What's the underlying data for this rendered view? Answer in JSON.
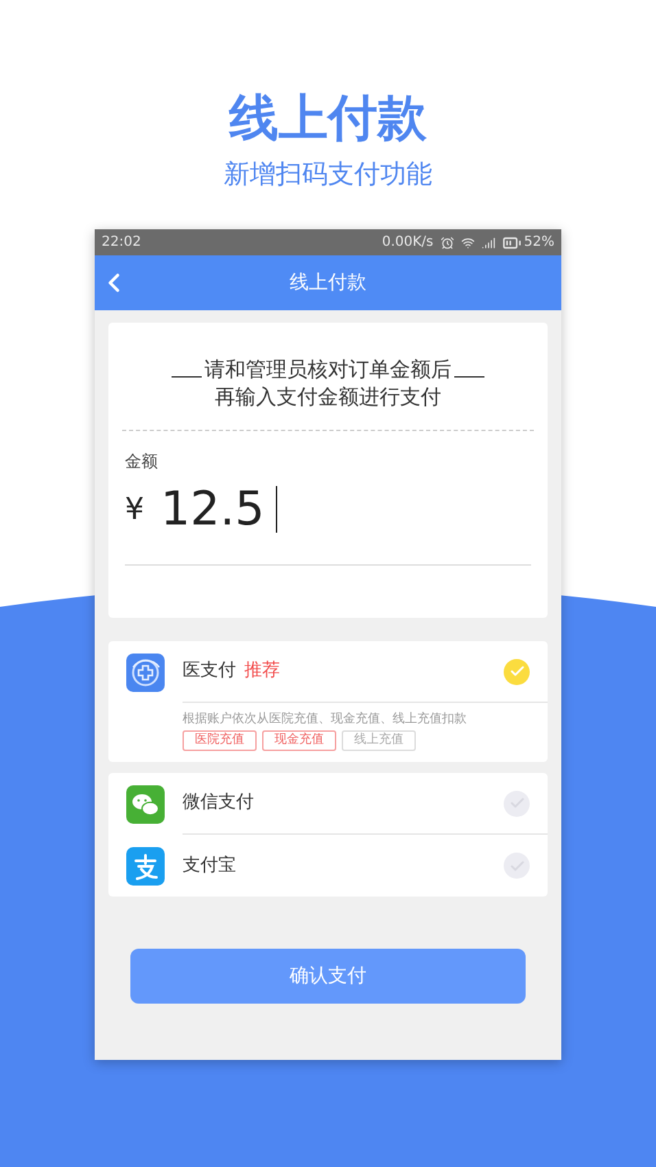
{
  "headline": "线上付款",
  "subheadline": "新增扫码支付功能",
  "status_bar": {
    "time": "22:02",
    "speed": "0.00K/s",
    "battery": "52%"
  },
  "header": {
    "title": "线上付款"
  },
  "notice": [
    "请和管理员核对订单金额后",
    "再输入支付金额进行支付"
  ],
  "amount": {
    "label": "金额",
    "currency": "¥",
    "value": "12.5"
  },
  "payment_groups": [
    {
      "methods": [
        {
          "kind": "yi",
          "name": "医支付",
          "badge": "推荐",
          "selected": true,
          "description": "根据账户依次从医院充值、现金充值、线上充值扣款",
          "tags": [
            {
              "label": "医院充值",
              "enabled": true
            },
            {
              "label": "现金充值",
              "enabled": true
            },
            {
              "label": "线上充值",
              "enabled": false
            }
          ]
        }
      ]
    },
    {
      "methods": [
        {
          "kind": "wechat",
          "name": "微信支付",
          "selected": false
        },
        {
          "kind": "alipay",
          "name": "支付宝",
          "selected": false
        }
      ]
    }
  ],
  "confirm_button": "确认支付"
}
